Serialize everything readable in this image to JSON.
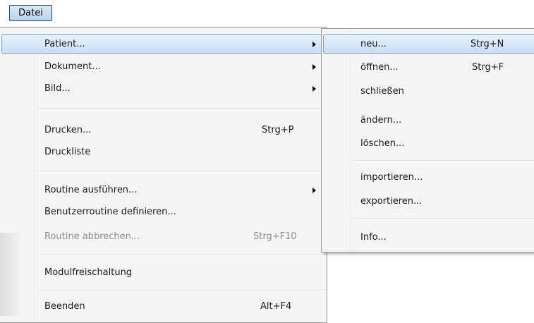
{
  "menubar": {
    "datei_label": "Datei"
  },
  "main_menu": {
    "patient": "Patient...",
    "dokument": "Dokument...",
    "bild": "Bild...",
    "drucken": "Drucken...",
    "drucken_shortcut": "Strg+P",
    "druckliste": "Druckliste",
    "routine_ausfuehren": "Routine ausführen...",
    "benutzerroutine": "Benutzerroutine definieren...",
    "routine_abbrechen": "Routine abbrechen...",
    "routine_abbrechen_shortcut": "Strg+F10",
    "modulfreischaltung": "Modulfreischaltung",
    "beenden": "Beenden",
    "beenden_shortcut": "Alt+F4"
  },
  "patient_submenu": {
    "neu": "neu...",
    "neu_shortcut": "Strg+N",
    "oeffnen": "öffnen...",
    "oeffnen_shortcut": "Strg+F",
    "schliessen": "schließen",
    "aendern": "ändern...",
    "loeschen": "löschen...",
    "importieren": "importieren...",
    "exportieren": "exportieren...",
    "info": "Info..."
  }
}
